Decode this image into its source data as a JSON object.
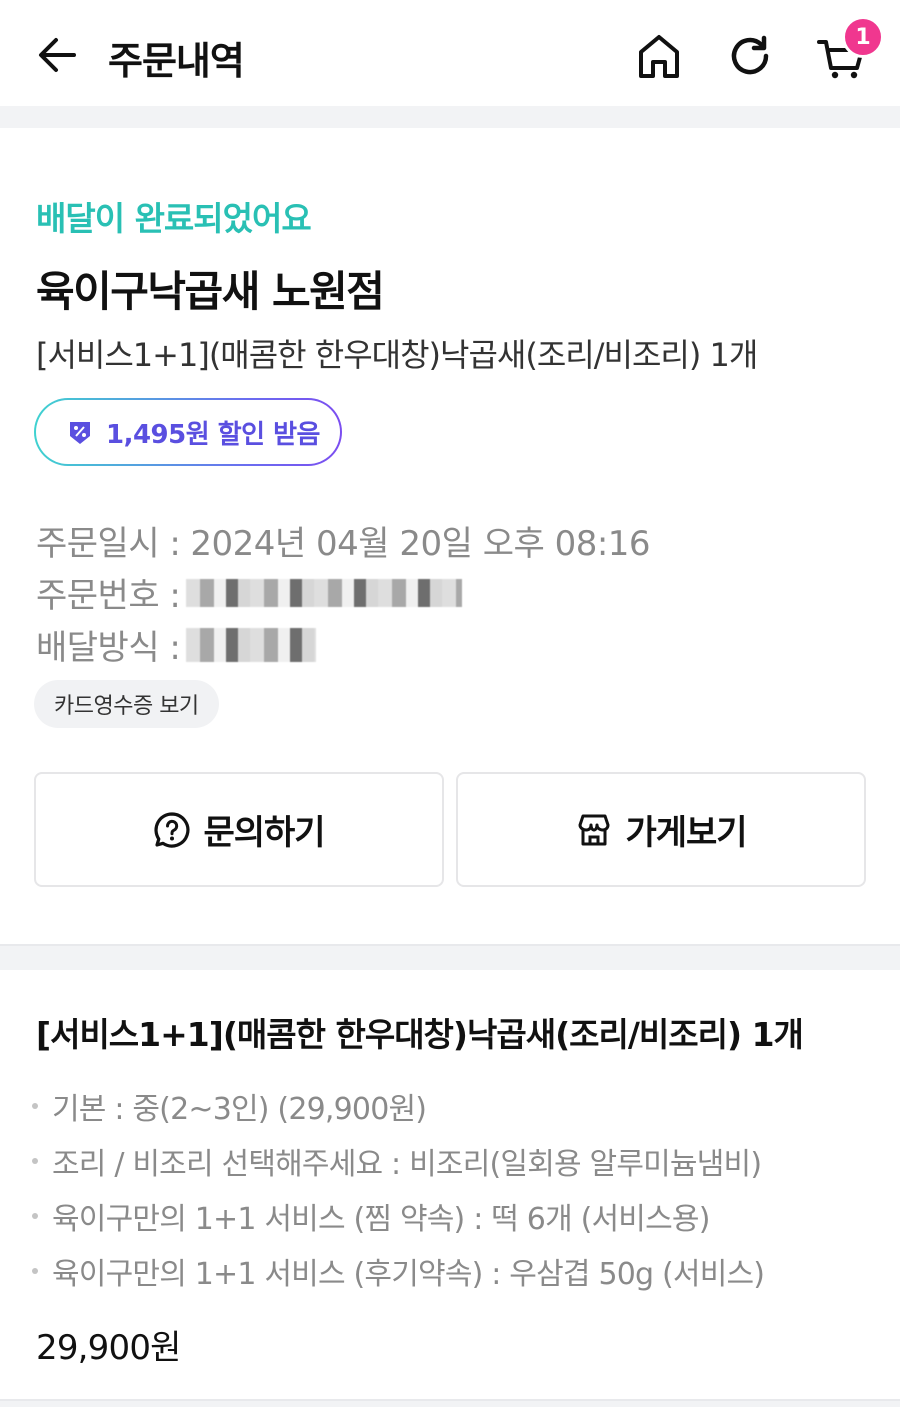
{
  "header": {
    "title": "주문내역",
    "cart_count": "1",
    "icons": [
      "back-arrow-icon",
      "home-icon",
      "refresh-icon",
      "cart-icon"
    ]
  },
  "order": {
    "status": "배달이 완료되었어요",
    "store_name": "육이구낙곱새 노원점",
    "summary": "[서비스1+1](매콤한 한우대창)낙곱새(조리/비조리) 1개",
    "discount": "1,495원 할인 받음",
    "order_time_label": "주문일시 :",
    "order_time_value": "2024년 04월 20일 오후 08:16",
    "order_number_label": "주문번호 :",
    "delivery_method_label": "배달방식 :",
    "receipt_button": "카드영수증 보기"
  },
  "actions": {
    "inquiry": "문의하기",
    "store": "가게보기"
  },
  "menu": {
    "title": "[서비스1+1](매콤한 한우대창)낙곱새(조리/비조리) 1개",
    "options": [
      "기본 : 중(2~3인) (29,900원)",
      "조리 / 비조리 선택해주세요 : 비조리(일회용 알루미늄냄비)",
      "육이구만의 1+1 서비스 (찜 약속) : 떡 6개 (서비스용)",
      "육이구만의 1+1 서비스 (후기약속) : 우삼겹 50g (서비스)"
    ],
    "price": "29,900원"
  },
  "colors": {
    "status_teal": "#29c0b4",
    "discount_purple": "#5a4fe0",
    "badge_pink": "#f0378f"
  }
}
